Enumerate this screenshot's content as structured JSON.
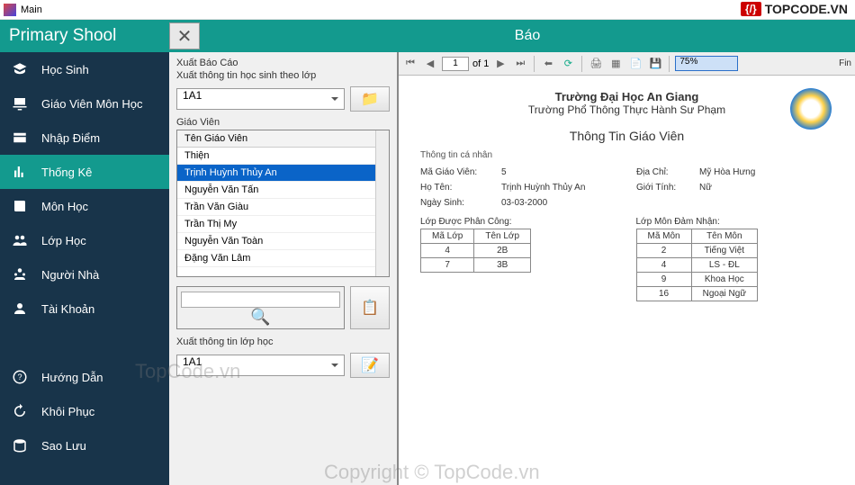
{
  "window": {
    "title": "Main"
  },
  "brand": {
    "label": "TOPCODE.VN"
  },
  "header": {
    "appTitle": "Primary Shool",
    "panelTitle": "Báo"
  },
  "sidebar": {
    "items": [
      {
        "label": "Học Sinh"
      },
      {
        "label": "Giáo Viên Môn Học"
      },
      {
        "label": "Nhập Điểm"
      },
      {
        "label": "Thống Kê"
      },
      {
        "label": "Môn Học"
      },
      {
        "label": "Lớp Học"
      },
      {
        "label": "Người Nhà"
      },
      {
        "label": "Tài Khoản"
      }
    ],
    "items2": [
      {
        "label": "Hướng Dẫn"
      },
      {
        "label": "Khôi Phục"
      },
      {
        "label": "Sao Lưu"
      }
    ]
  },
  "mid": {
    "sec1Title": "Xuất Báo Cáo",
    "sec1Sub": "Xuất thông tin học sinh theo lớp",
    "combo1": "1A1",
    "listLabel": "Giáo Viên",
    "listHeader": "Tên Giáo Viên",
    "teachers": [
      "Thiện",
      "Trịnh Huỳnh Thủy An",
      "Nguyễn Văn Tấn",
      "Trần Văn Giàu",
      "Trần Thị My",
      "Nguyễn Văn Toàn",
      "Đặng Văn Lâm"
    ],
    "sec2Title": "Xuất thông tin lớp học",
    "combo2": "1A1"
  },
  "reportToolbar": {
    "page": "1",
    "pageOf": "of  1",
    "zoom": "75%",
    "find": "Fin"
  },
  "report": {
    "uni1": "Trường Đại Học An Giang",
    "uni2": "Trường Phổ Thông Thực Hành Sư Phạm",
    "title": "Thông Tin Giáo Viên",
    "sub": "Thông tin cá nhân",
    "f": {
      "maGVLabel": "Mã Giáo Viên:",
      "maGV": "5",
      "diaChiLabel": "Địa Chỉ:",
      "diaChi": "Mỹ Hòa Hưng",
      "hoTenLabel": "Họ Tên:",
      "hoTen": "Trịnh Huỳnh Thủy An",
      "gioiTinhLabel": "Giới Tính:",
      "gioiTinh": "Nữ",
      "ngaySinhLabel": "Ngày Sinh:",
      "ngaySinh": "03-03-2000"
    },
    "t1": {
      "cap": "Lớp Được Phân Công:",
      "h": [
        "Mã Lớp",
        "Tên Lớp"
      ],
      "rows": [
        [
          "4",
          "2B"
        ],
        [
          "7",
          "3B"
        ]
      ]
    },
    "t2": {
      "cap": "Lớp Môn Đảm Nhận:",
      "h": [
        "Mã Môn",
        "Tên Môn"
      ],
      "rows": [
        [
          "2",
          "Tiếng Việt"
        ],
        [
          "4",
          "LS - ĐL"
        ],
        [
          "9",
          "Khoa Học"
        ],
        [
          "16",
          "Ngoại Ngữ"
        ]
      ]
    }
  },
  "watermarks": {
    "w1": "TopCode.vn",
    "w2": "Copyright © TopCode.vn"
  }
}
